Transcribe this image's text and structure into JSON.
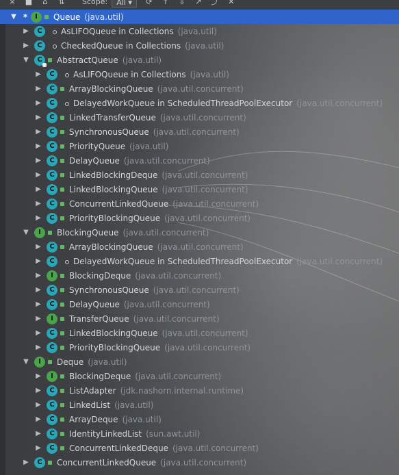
{
  "toolbar": {
    "buttons": [
      {
        "icon": "close-icon",
        "glyph": "×"
      },
      {
        "icon": "stop-icon",
        "glyph": "■"
      },
      {
        "icon": "hierarchy-icon",
        "glyph": "⌂"
      },
      {
        "icon": "sort-icon",
        "glyph": "⇅"
      },
      {
        "icon": "refresh-icon",
        "glyph": "⟳"
      },
      {
        "icon": "up-icon",
        "glyph": "↑"
      },
      {
        "icon": "download-icon",
        "glyph": "⇩"
      },
      {
        "icon": "arrow-icon",
        "glyph": "↗"
      },
      {
        "icon": "export-icon",
        "glyph": "⤴"
      },
      {
        "icon": "close-icon",
        "glyph": "✕"
      }
    ],
    "scope_label": "Scope:",
    "scope_value": "All"
  },
  "tree": {
    "rows": [
      {
        "text": "Queue",
        "pkg": "(java.util)",
        "indent": 0,
        "twisty": "down",
        "icon": "i",
        "vis": "public",
        "selected": true,
        "star": "*"
      },
      {
        "text": "AsLIFOQueue in Collections",
        "pkg": "(java.util)",
        "indent": 1,
        "twisty": "right",
        "icon": "c",
        "vis": "pkg"
      },
      {
        "text": "CheckedQueue in Collections",
        "pkg": "(java.util)",
        "indent": 1,
        "twisty": "right",
        "icon": "c",
        "vis": "pkg"
      },
      {
        "text": "AbstractQueue",
        "pkg": "(java.util)",
        "indent": 1,
        "twisty": "down",
        "icon": "abstract",
        "vis": "public"
      },
      {
        "text": "AsLIFOQueue in Collections",
        "pkg": "(java.util)",
        "indent": 2,
        "twisty": "right",
        "icon": "c",
        "vis": "pkg"
      },
      {
        "text": "ArrayBlockingQueue",
        "pkg": "(java.util.concurrent)",
        "indent": 2,
        "twisty": "right",
        "icon": "c",
        "vis": "public"
      },
      {
        "text": "DelayedWorkQueue in ScheduledThreadPoolExecutor",
        "pkg": "(java.util.concurrent)",
        "indent": 2,
        "twisty": "right",
        "icon": "c",
        "vis": "pkg"
      },
      {
        "text": "LinkedTransferQueue",
        "pkg": "(java.util.concurrent)",
        "indent": 2,
        "twisty": "right",
        "icon": "c",
        "vis": "public"
      },
      {
        "text": "SynchronousQueue",
        "pkg": "(java.util.concurrent)",
        "indent": 2,
        "twisty": "right",
        "icon": "c",
        "vis": "public"
      },
      {
        "text": "PriorityQueue",
        "pkg": "(java.util)",
        "indent": 2,
        "twisty": "right",
        "icon": "c",
        "vis": "public"
      },
      {
        "text": "DelayQueue",
        "pkg": "(java.util.concurrent)",
        "indent": 2,
        "twisty": "right",
        "icon": "c",
        "vis": "public"
      },
      {
        "text": "LinkedBlockingDeque",
        "pkg": "(java.util.concurrent)",
        "indent": 2,
        "twisty": "right",
        "icon": "c",
        "vis": "public"
      },
      {
        "text": "LinkedBlockingQueue",
        "pkg": "(java.util.concurrent)",
        "indent": 2,
        "twisty": "right",
        "icon": "c",
        "vis": "public"
      },
      {
        "text": "ConcurrentLinkedQueue",
        "pkg": "(java.util.concurrent)",
        "indent": 2,
        "twisty": "right",
        "icon": "c",
        "vis": "public"
      },
      {
        "text": "PriorityBlockingQueue",
        "pkg": "(java.util.concurrent)",
        "indent": 2,
        "twisty": "right",
        "icon": "c",
        "vis": "public"
      },
      {
        "text": "BlockingQueue",
        "pkg": "(java.util.concurrent)",
        "indent": 1,
        "twisty": "down",
        "icon": "i",
        "vis": "public"
      },
      {
        "text": "ArrayBlockingQueue",
        "pkg": "(java.util.concurrent)",
        "indent": 2,
        "twisty": "right",
        "icon": "c",
        "vis": "public"
      },
      {
        "text": "DelayedWorkQueue in ScheduledThreadPoolExecutor",
        "pkg": "(java.util.concurrent)",
        "indent": 2,
        "twisty": "right",
        "icon": "c",
        "vis": "pkg"
      },
      {
        "text": "BlockingDeque",
        "pkg": "(java.util.concurrent)",
        "indent": 2,
        "twisty": "right",
        "icon": "i",
        "vis": "public"
      },
      {
        "text": "SynchronousQueue",
        "pkg": "(java.util.concurrent)",
        "indent": 2,
        "twisty": "right",
        "icon": "c",
        "vis": "public"
      },
      {
        "text": "DelayQueue",
        "pkg": "(java.util.concurrent)",
        "indent": 2,
        "twisty": "right",
        "icon": "c",
        "vis": "public"
      },
      {
        "text": "TransferQueue",
        "pkg": "(java.util.concurrent)",
        "indent": 2,
        "twisty": "right",
        "icon": "i",
        "vis": "public"
      },
      {
        "text": "LinkedBlockingQueue",
        "pkg": "(java.util.concurrent)",
        "indent": 2,
        "twisty": "right",
        "icon": "c",
        "vis": "public"
      },
      {
        "text": "PriorityBlockingQueue",
        "pkg": "(java.util.concurrent)",
        "indent": 2,
        "twisty": "right",
        "icon": "c",
        "vis": "public"
      },
      {
        "text": "Deque",
        "pkg": "(java.util)",
        "indent": 1,
        "twisty": "down",
        "icon": "i",
        "vis": "public"
      },
      {
        "text": "BlockingDeque",
        "pkg": "(java.util.concurrent)",
        "indent": 2,
        "twisty": "right",
        "icon": "i",
        "vis": "public"
      },
      {
        "text": "ListAdapter",
        "pkg": "(jdk.nashorn.internal.runtime)",
        "indent": 2,
        "twisty": "right",
        "icon": "c",
        "vis": "public"
      },
      {
        "text": "LinkedList",
        "pkg": "(java.util)",
        "indent": 2,
        "twisty": "right",
        "icon": "c",
        "vis": "public"
      },
      {
        "text": "ArrayDeque",
        "pkg": "(java.util)",
        "indent": 2,
        "twisty": "right",
        "icon": "c",
        "vis": "public"
      },
      {
        "text": "IdentityLinkedList",
        "pkg": "(sun.awt.util)",
        "indent": 2,
        "twisty": "right",
        "icon": "c",
        "vis": "public"
      },
      {
        "text": "ConcurrentLinkedDeque",
        "pkg": "(java.util.concurrent)",
        "indent": 2,
        "twisty": "right",
        "icon": "c",
        "vis": "public"
      },
      {
        "text": "ConcurrentLinkedQueue",
        "pkg": "(java.util.concurrent)",
        "indent": 1,
        "twisty": "right",
        "icon": "c",
        "vis": "public"
      }
    ]
  }
}
